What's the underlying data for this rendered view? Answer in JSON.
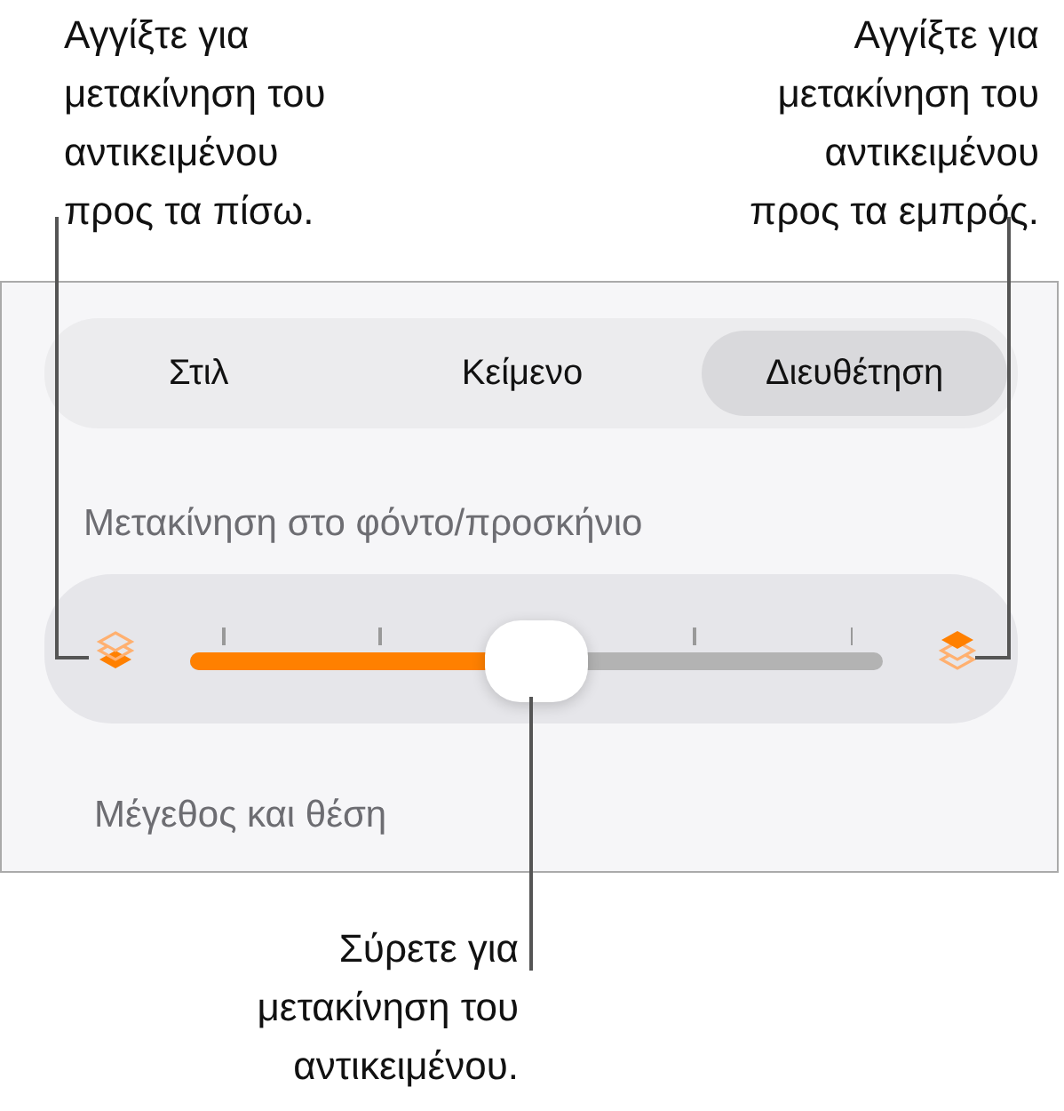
{
  "callouts_top": [
    {
      "text": "Αγγίξτε για\nμετακίνηση του\nαντικειμένου\nπρος τα πίσω."
    },
    {
      "text": "Αγγίξτε για\nμετακίνηση του\nαντικειμένου\nπρος τα εμπρός."
    }
  ],
  "tabs": [
    {
      "label": "Στιλ",
      "selected": false
    },
    {
      "label": "Κείμενο",
      "selected": false
    },
    {
      "label": "Διευθέτηση",
      "selected": true
    }
  ],
  "section_heading": "Μετακίνηση στο φόντο/προσκήνιο",
  "arrange_slider": {
    "level": 0.5
  },
  "next_section": "Μέγεθος και θέση",
  "callout_bottom": "Σύρετε για\nμετακίνηση του\nαντικειμένου."
}
